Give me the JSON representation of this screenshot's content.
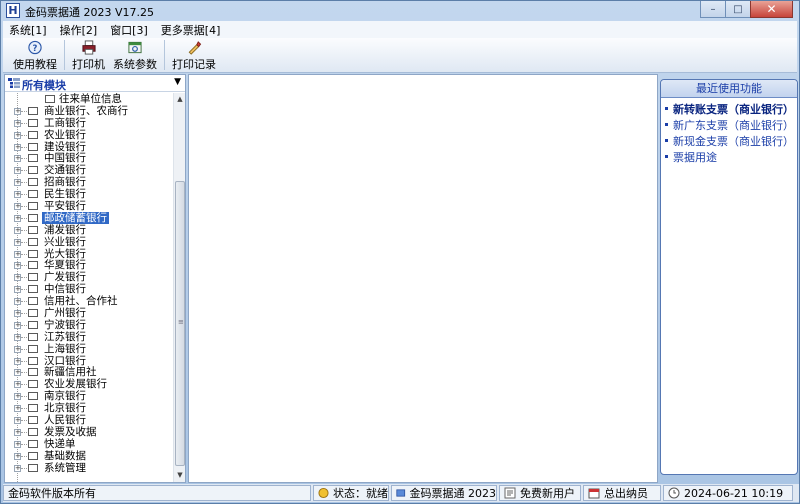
{
  "window": {
    "title": "金码票据通 2023   V17.25",
    "app_icon_letter": "H",
    "min_glyph": "–",
    "max_glyph": "□",
    "close_glyph": "✕"
  },
  "menu": [
    "系统[1]",
    "操作[2]",
    "窗口[3]",
    "更多票据[4]"
  ],
  "toolbar": [
    {
      "label": "使用教程",
      "icon": "help-icon"
    },
    {
      "label": "打印机",
      "icon": "printer-icon"
    },
    {
      "label": "系统参数",
      "icon": "settings-icon"
    },
    {
      "label": "打印记录",
      "icon": "print-log-icon"
    }
  ],
  "module_select": {
    "label": "所有模块"
  },
  "tree": {
    "child_item": "往来单位信息",
    "items": [
      "商业银行、农商行",
      "工商银行",
      "农业银行",
      "建设银行",
      "中国银行",
      "交通银行",
      "招商银行",
      "民生银行",
      "平安银行",
      "邮政储蓄银行",
      "浦发银行",
      "兴业银行",
      "光大银行",
      "华夏银行",
      "广发银行",
      "中信银行",
      "信用社、合作社",
      "广州银行",
      "宁波银行",
      "江苏银行",
      "上海银行",
      "汉口银行",
      "新疆信用社",
      "农业发展银行",
      "南京银行",
      "北京银行",
      "人民银行",
      "发票及收据",
      "快递单",
      "基础数据",
      "系统管理"
    ],
    "selected_index": 9
  },
  "recent": {
    "title": "最近使用功能",
    "items": [
      "新转账支票（商业银行）",
      "新广东支票（商业银行）",
      "新现金支票（商业银行）",
      "票据用途"
    ]
  },
  "status": {
    "copyright": "金码软件版本所有",
    "state": "状态：就绪",
    "app": "金码票据通 2023",
    "user": "免费新用户",
    "role": "总出纳员",
    "datetime": "2024-06-21 10:19"
  },
  "colors": {
    "accent": "#1b3ea8",
    "selection": "#3169c6",
    "frame": "#b9d1ea"
  }
}
